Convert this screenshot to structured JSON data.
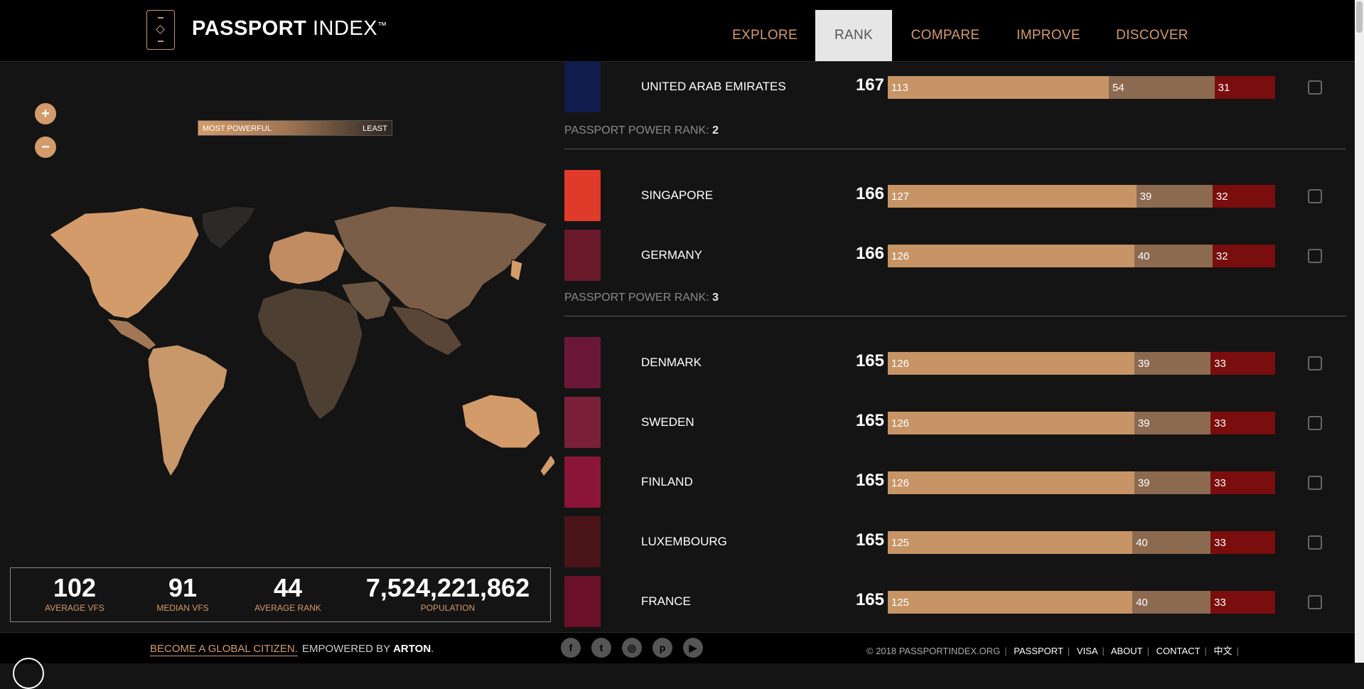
{
  "header": {
    "brand_bold": "PASSPORT",
    "brand_light": "INDEX",
    "brand_tm": "™",
    "nav": [
      "EXPLORE",
      "RANK",
      "COMPARE",
      "IMPROVE",
      "DISCOVER"
    ],
    "active_nav": "RANK"
  },
  "map_panel": {
    "zoom_in": "+",
    "zoom_out": "−",
    "legend_most": "MOST POWERFUL",
    "legend_least": "LEAST"
  },
  "stats": [
    {
      "value": "102",
      "label": "AVERAGE VFS"
    },
    {
      "value": "91",
      "label": "MEDIAN VFS"
    },
    {
      "value": "44",
      "label": "AVERAGE RANK"
    },
    {
      "value": "7,524,221,862",
      "label": "POPULATION"
    }
  ],
  "ranking": {
    "rank_prefix": "PASSPORT POWER RANK:",
    "groups": [
      {
        "rank": "2"
      },
      {
        "rank": "3"
      }
    ],
    "rows": [
      {
        "country": "UNITED ARAB EMIRATES",
        "score": "167",
        "visa_free": 113,
        "visa_on_arrival": 54,
        "visa_required": 31,
        "flag_color": "#0f1c4d"
      },
      {
        "country": "SINGAPORE",
        "score": "166",
        "visa_free": 127,
        "visa_on_arrival": 39,
        "visa_required": 32,
        "flag_color": "#e03a2a"
      },
      {
        "country": "GERMANY",
        "score": "166",
        "visa_free": 126,
        "visa_on_arrival": 40,
        "visa_required": 32,
        "flag_color": "#6a1a2a"
      },
      {
        "country": "DENMARK",
        "score": "165",
        "visa_free": 126,
        "visa_on_arrival": 39,
        "visa_required": 33,
        "flag_color": "#6b1838"
      },
      {
        "country": "SWEDEN",
        "score": "165",
        "visa_free": 126,
        "visa_on_arrival": 39,
        "visa_required": 33,
        "flag_color": "#7a2038"
      },
      {
        "country": "FINLAND",
        "score": "165",
        "visa_free": 126,
        "visa_on_arrival": 39,
        "visa_required": 33,
        "flag_color": "#8a1538"
      },
      {
        "country": "LUXEMBOURG",
        "score": "165",
        "visa_free": 125,
        "visa_on_arrival": 40,
        "visa_required": 33,
        "flag_color": "#4a1418"
      },
      {
        "country": "FRANCE",
        "score": "165",
        "visa_free": 125,
        "visa_on_arrival": 40,
        "visa_required": 33,
        "flag_color": "#6a1028"
      }
    ]
  },
  "footer": {
    "cta": "BECOME A GLOBAL CITIZEN.",
    "empowered": "EMPOWERED BY",
    "empowered_brand": "ARTON",
    "social": [
      "facebook-icon",
      "twitter-icon",
      "instagram-icon",
      "pinterest-icon",
      "youtube-icon"
    ],
    "copyright": "© 2018 PASSPORTINDEX.ORG",
    "links": [
      "PASSPORT",
      "VISA",
      "ABOUT",
      "CONTACT",
      "中文"
    ]
  },
  "colors": {
    "accent": "#d39b6a",
    "visa_free": "#c79466",
    "visa_on_arrival": "#8c6a50",
    "visa_required": "#7a0d0d"
  }
}
